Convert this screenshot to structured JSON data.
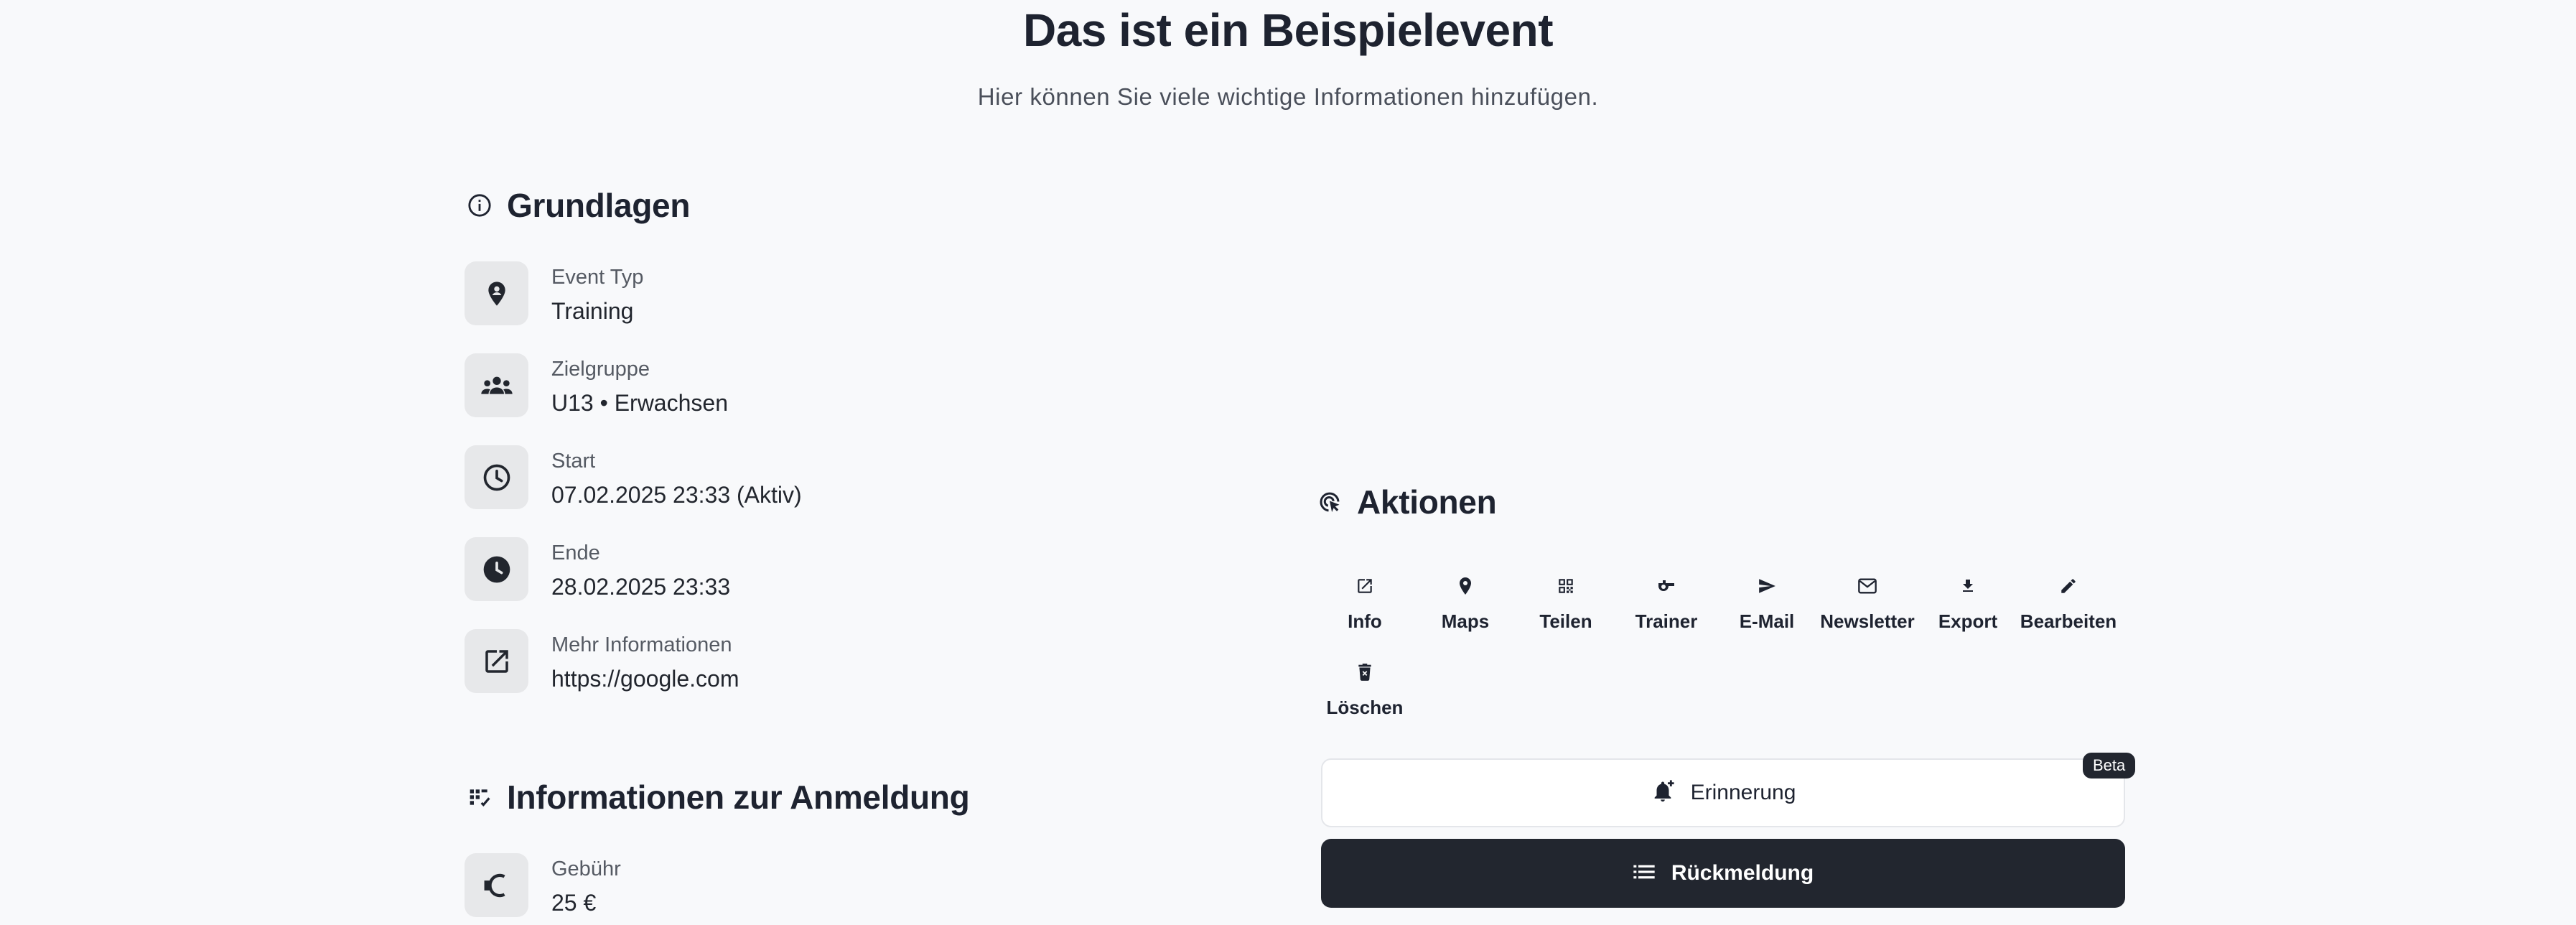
{
  "header": {
    "title": "Das ist ein Beispielevent",
    "subtitle": "Hier können Sie viele wichtige Informationen hinzufügen."
  },
  "basics": {
    "heading": "Grundlagen",
    "heading_icon": "info-circle-icon",
    "rows": [
      {
        "label": "Event Typ",
        "value": "Training",
        "icon": "person-pin-icon"
      },
      {
        "label": "Zielgruppe",
        "value": "U13 • Erwachsen",
        "icon": "groups-icon"
      },
      {
        "label": "Start",
        "value": "07.02.2025 23:33 (Aktiv)",
        "icon": "clock-outline-icon"
      },
      {
        "label": "Ende",
        "value": "28.02.2025 23:33",
        "icon": "clock-filled-icon"
      },
      {
        "label": "Mehr Informationen",
        "value": "https://google.com",
        "icon": "open-in-new-icon"
      }
    ]
  },
  "registration": {
    "heading": "Informationen zur Anmeldung",
    "heading_icon": "checklist-icon",
    "rows": [
      {
        "label": "Gebühr",
        "value": "25 €",
        "icon": "euro-icon"
      }
    ]
  },
  "actions": {
    "heading": "Aktionen",
    "heading_icon": "ads-click-icon",
    "items": [
      {
        "label": "Info",
        "icon": "open-in-new-icon"
      },
      {
        "label": "Maps",
        "icon": "map-pin-icon"
      },
      {
        "label": "Teilen",
        "icon": "qr-code-icon"
      },
      {
        "label": "Trainer",
        "icon": "whistle-icon"
      },
      {
        "label": "E-Mail",
        "icon": "send-icon"
      },
      {
        "label": "Newsletter",
        "icon": "mail-icon"
      },
      {
        "label": "Export",
        "icon": "download-icon"
      },
      {
        "label": "Bearbeiten",
        "icon": "pencil-icon"
      },
      {
        "label": "Löschen",
        "icon": "trash-icon"
      }
    ],
    "reminder_label": "Erinnerung",
    "reminder_badge": "Beta",
    "response_label": "Rückmeldung"
  }
}
